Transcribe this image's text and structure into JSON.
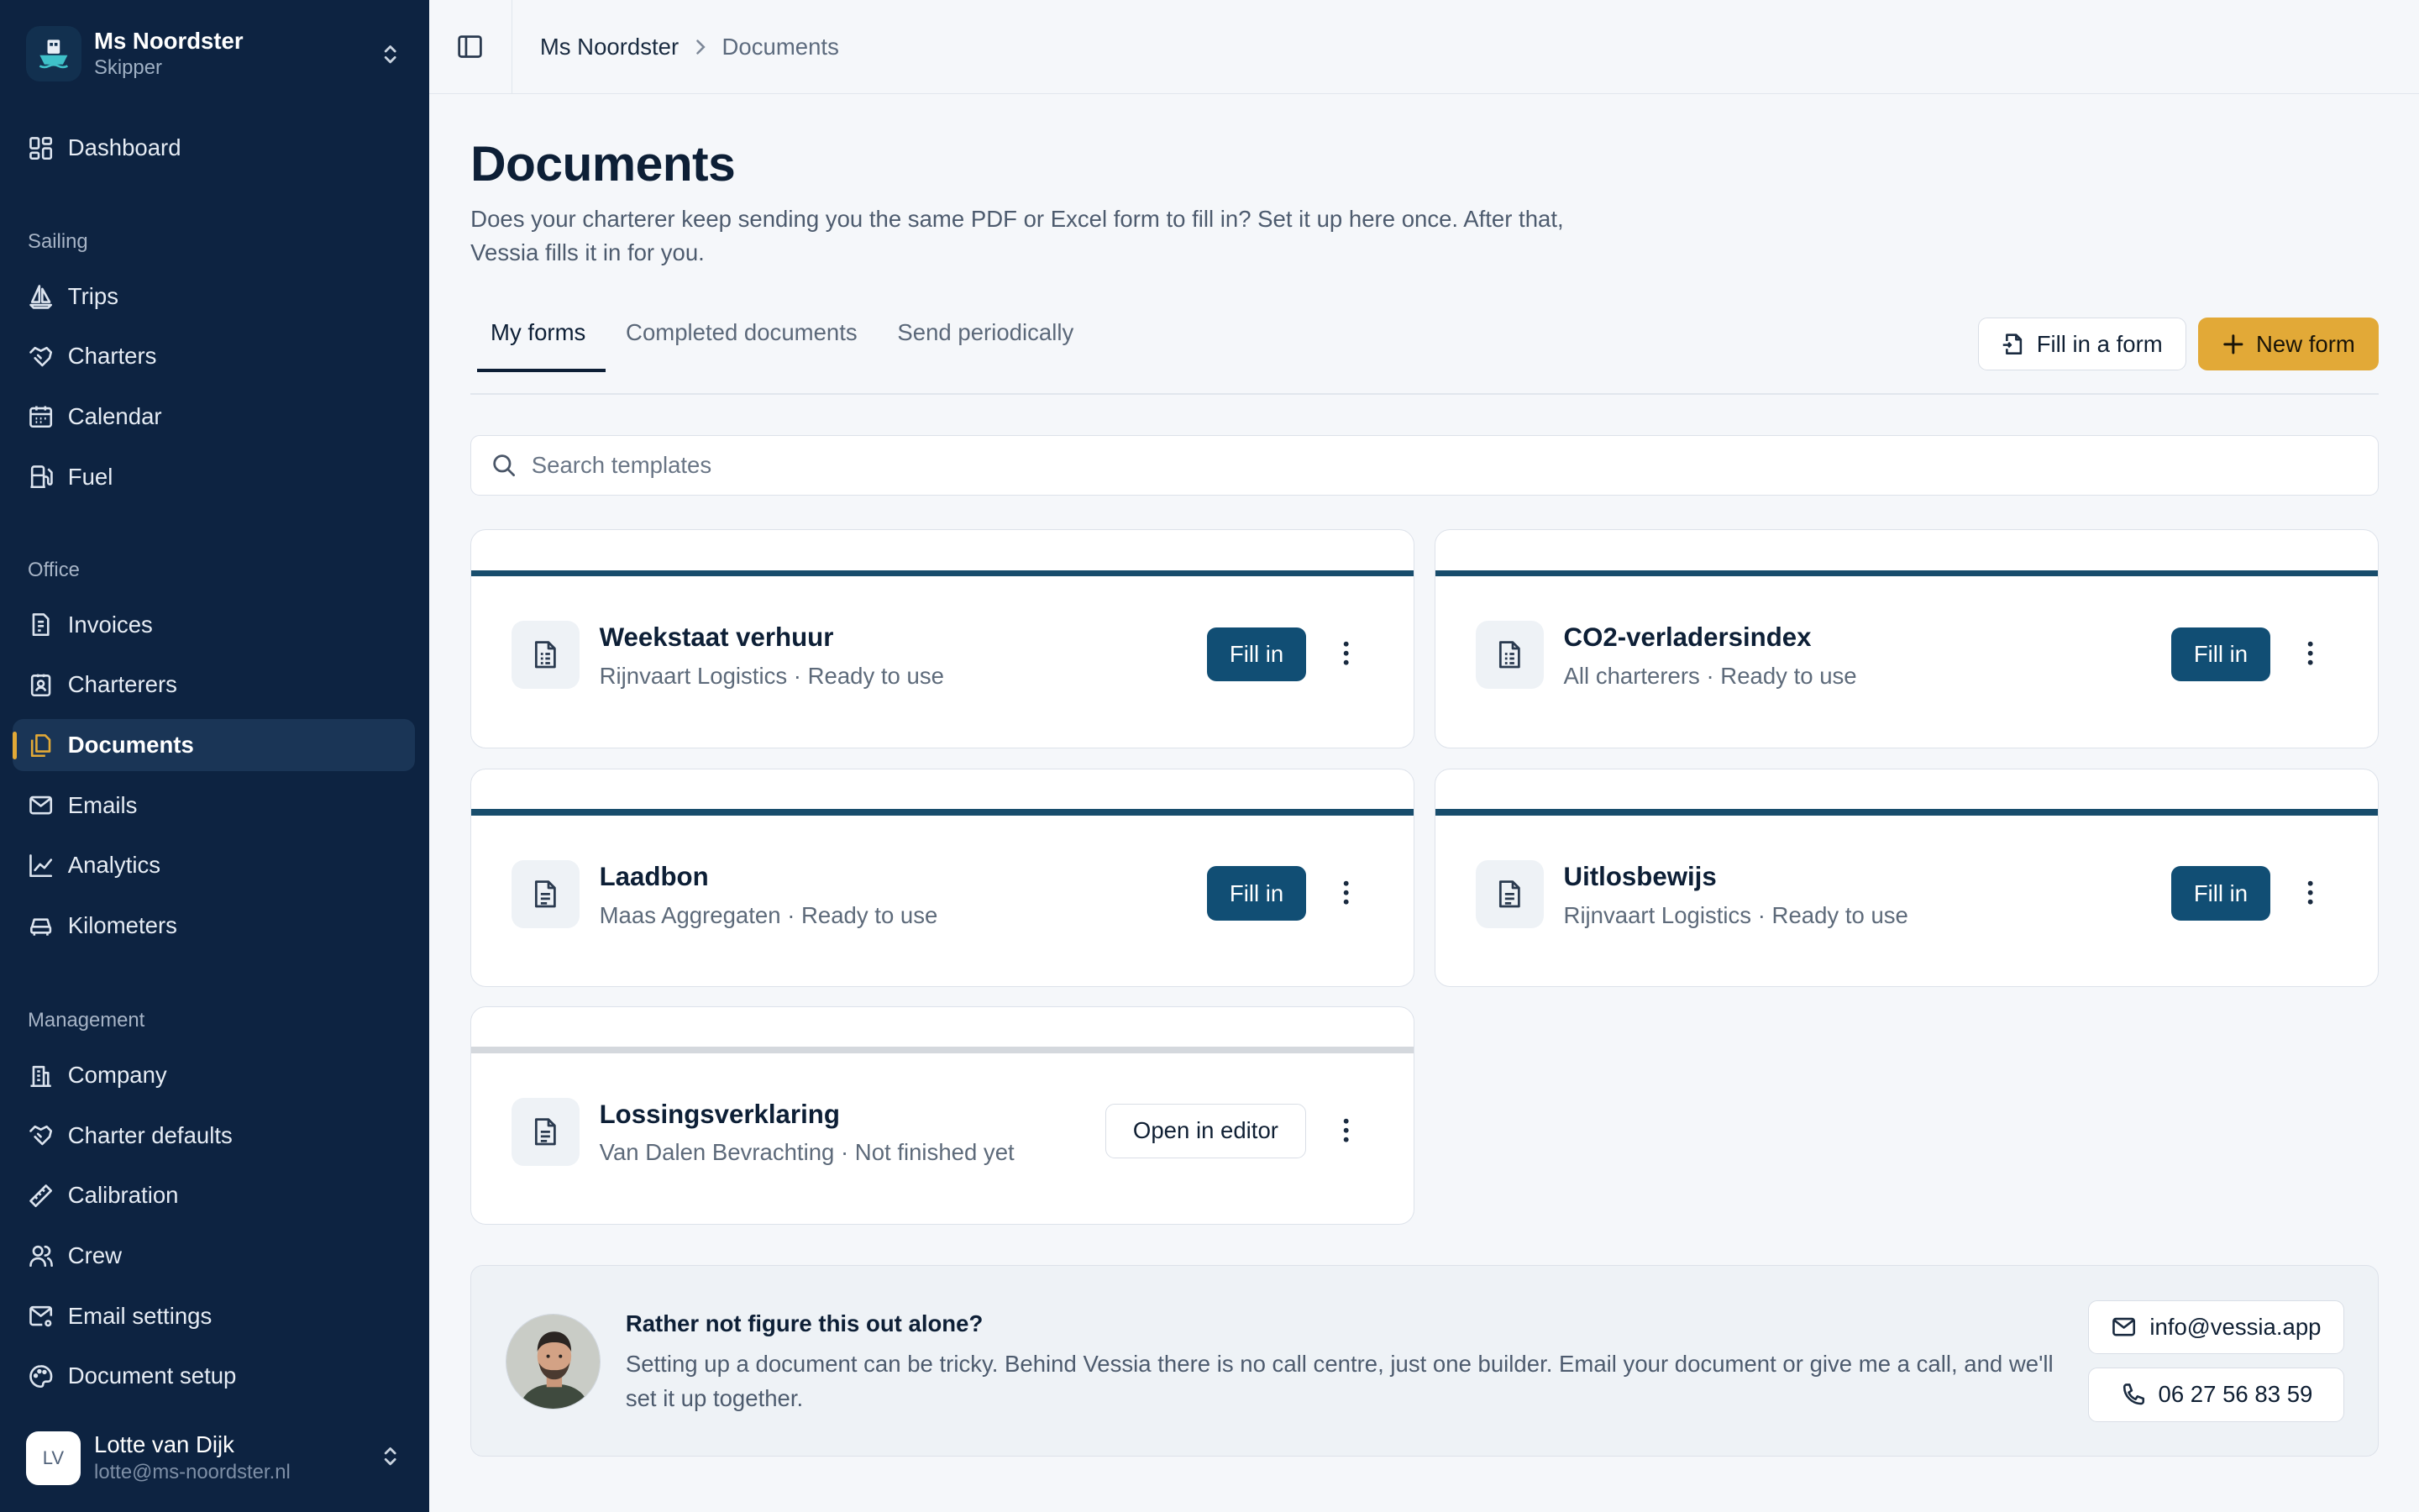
{
  "ship": {
    "name": "Ms Noordster",
    "role": "Skipper"
  },
  "nav": {
    "dashboard": "Dashboard",
    "section_sailing": "Sailing",
    "trips": "Trips",
    "charters": "Charters",
    "calendar": "Calendar",
    "fuel": "Fuel",
    "section_office": "Office",
    "invoices": "Invoices",
    "charterers": "Charterers",
    "documents": "Documents",
    "emails": "Emails",
    "analytics": "Analytics",
    "kilometers": "Kilometers",
    "section_management": "Management",
    "company": "Company",
    "charter_defaults": "Charter defaults",
    "calibration": "Calibration",
    "crew": "Crew",
    "email_settings": "Email settings",
    "document_setup": "Document setup"
  },
  "user": {
    "initials": "LV",
    "name": "Lotte van Dijk",
    "email": "lotte@ms-noordster.nl"
  },
  "breadcrumb": {
    "root": "Ms Noordster",
    "current": "Documents"
  },
  "page": {
    "title": "Documents",
    "description": "Does your charterer keep sending you the same PDF or Excel form to fill in? Set it up here once. After that, Vessia fills it in for you."
  },
  "tabs": {
    "my_forms": "My forms",
    "completed": "Completed documents",
    "send_periodically": "Send periodically"
  },
  "actions": {
    "fill_in_form": "Fill in a form",
    "new_form": "New form"
  },
  "search": {
    "placeholder": "Search templates"
  },
  "forms": [
    {
      "title": "Weekstaat verhuur",
      "subtitle": "Rijnvaart Logistics · Ready to use",
      "action": "Fill in"
    },
    {
      "title": "CO2-verladersindex",
      "subtitle": "All charterers · Ready to use",
      "action": "Fill in"
    },
    {
      "title": "Laadbon",
      "subtitle": "Maas Aggregaten · Ready to use",
      "action": "Fill in"
    },
    {
      "title": "Uitlosbewijs",
      "subtitle": "Rijnvaart Logistics · Ready to use",
      "action": "Fill in"
    },
    {
      "title": "Lossingsverklaring",
      "subtitle": "Van Dalen Bevrachting · Not finished yet",
      "action": "Open in editor"
    }
  ],
  "help": {
    "title": "Rather not figure this out alone?",
    "text": "Setting up a document can be tricky. Behind Vessia there is no call centre, just one builder. Email your document or give me a call, and we'll set it up together.",
    "email": "info@vessia.app",
    "phone": "06 27 56 83 59"
  },
  "colors": {
    "sidebar": "#0d2341",
    "accent": "#e2a937",
    "primary": "#114e74",
    "card_bar": "#184d6c"
  }
}
